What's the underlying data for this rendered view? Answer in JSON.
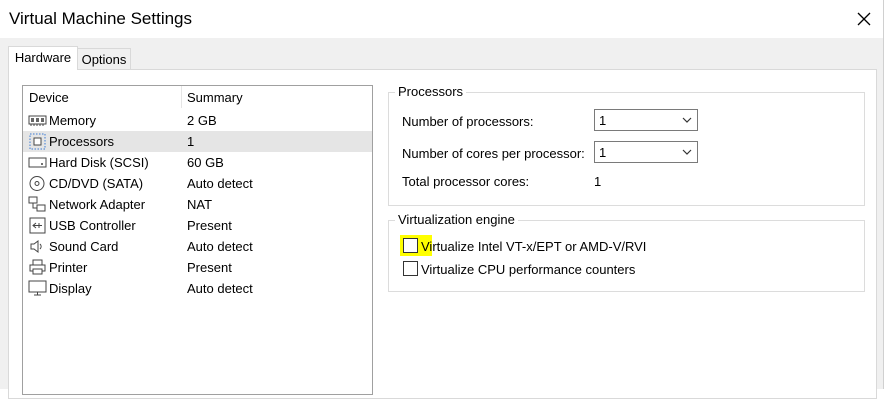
{
  "window": {
    "title": "Virtual Machine Settings"
  },
  "tabs": [
    {
      "label": "Hardware",
      "active": true
    },
    {
      "label": "Options",
      "active": false
    }
  ],
  "device_list": {
    "headers": {
      "device": "Device",
      "summary": "Summary"
    },
    "rows": [
      {
        "device": "Memory",
        "summary": "2 GB",
        "icon": "memory-icon"
      },
      {
        "device": "Processors",
        "summary": "1",
        "icon": "processor-icon",
        "selected": true
      },
      {
        "device": "Hard Disk (SCSI)",
        "summary": "60 GB",
        "icon": "hard-disk-icon"
      },
      {
        "device": "CD/DVD (SATA)",
        "summary": "Auto detect",
        "icon": "cd-dvd-icon"
      },
      {
        "device": "Network Adapter",
        "summary": "NAT",
        "icon": "network-adapter-icon"
      },
      {
        "device": "USB Controller",
        "summary": "Present",
        "icon": "usb-controller-icon"
      },
      {
        "device": "Sound Card",
        "summary": "Auto detect",
        "icon": "sound-card-icon"
      },
      {
        "device": "Printer",
        "summary": "Present",
        "icon": "printer-icon"
      },
      {
        "device": "Display",
        "summary": "Auto detect",
        "icon": "display-icon"
      }
    ]
  },
  "processors": {
    "group_label": "Processors",
    "num_processors_label": "Number of processors:",
    "num_processors_value": "1",
    "cores_label": "Number of cores per processor:",
    "cores_value": "1",
    "total_label": "Total processor cores:",
    "total_value": "1"
  },
  "virtualization": {
    "group_label": "Virtualization engine",
    "vtx_label": "Virtualize Intel VT-x/EPT or AMD-V/RVI",
    "vtx_checked": false,
    "perf_label": "Virtualize CPU performance counters",
    "perf_checked": false
  },
  "colors": {
    "selected_row": "#e5e5e5",
    "highlight": "#ffff00",
    "panel_bg": "#f0f0f0"
  }
}
